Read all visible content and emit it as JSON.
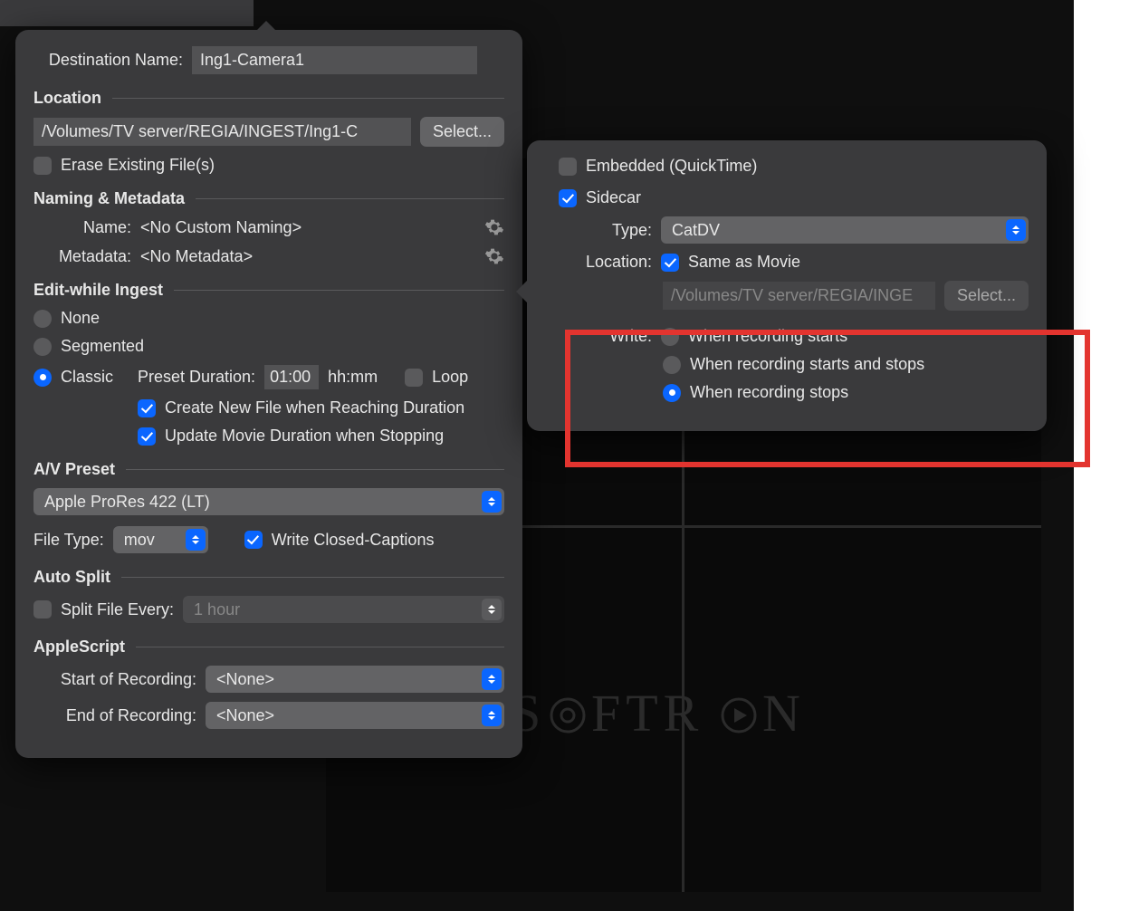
{
  "main": {
    "destinationName": {
      "label": "Destination Name:",
      "value": "Ing1-Camera1"
    },
    "location": {
      "header": "Location",
      "path": "/Volumes/TV server/REGIA/INGEST/Ing1-C",
      "selectBtn": "Select...",
      "eraseLabel": "Erase Existing File(s)"
    },
    "naming": {
      "header": "Naming & Metadata",
      "nameLabel": "Name:",
      "nameValue": "<No Custom Naming>",
      "metaLabel": "Metadata:",
      "metaValue": "<No Metadata>"
    },
    "ewi": {
      "header": "Edit-while Ingest",
      "none": "None",
      "segmented": "Segmented",
      "classic": "Classic",
      "presetDuration": "Preset Duration:",
      "presetValue": "01:00",
      "presetUnit": "hh:mm",
      "loop": "Loop",
      "createNew": "Create New File when Reaching Duration",
      "updateMovie": "Update Movie Duration when Stopping"
    },
    "av": {
      "header": "A/V Preset",
      "preset": "Apple ProRes 422 (LT)",
      "fileTypeLabel": "File Type:",
      "fileType": "mov",
      "writeCC": "Write Closed-Captions"
    },
    "autoSplit": {
      "header": "Auto Split",
      "splitLabel": "Split File Every:",
      "splitValue": "1 hour"
    },
    "appleScript": {
      "header": "AppleScript",
      "startLabel": "Start of Recording:",
      "startValue": "<None>",
      "endLabel": "End of Recording:",
      "endValue": "<None>"
    }
  },
  "sub": {
    "embedded": "Embedded (QuickTime)",
    "sidecar": "Sidecar",
    "typeLabel": "Type:",
    "typeValue": "CatDV",
    "locationLabel": "Location:",
    "sameAsMovie": "Same as Movie",
    "locationPath": "/Volumes/TV server/REGIA/INGE",
    "selectBtn": "Select...",
    "writeLabel": "Write:",
    "writeOpts": {
      "starts": "When recording starts",
      "startsStops": "When recording starts and stops",
      "stops": "When recording stops"
    }
  },
  "logo": "SOFTRON"
}
